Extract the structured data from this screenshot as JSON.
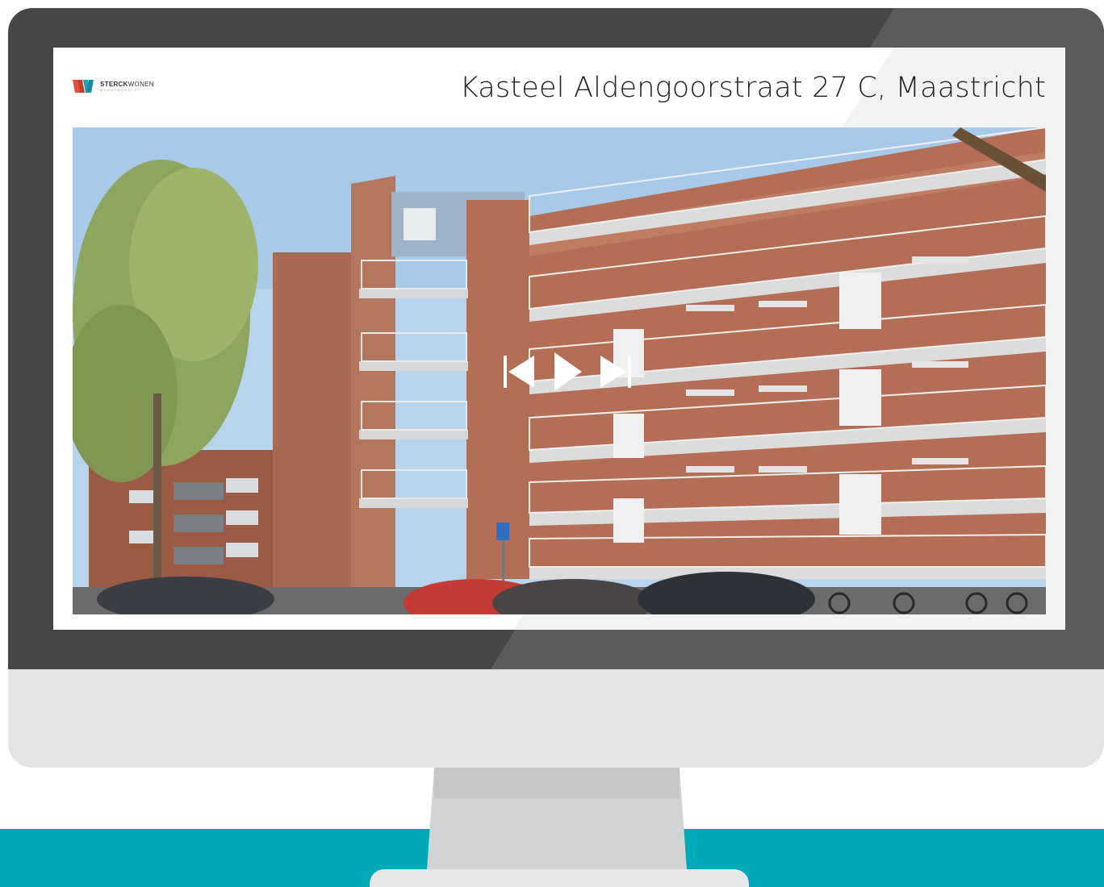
{
  "window": {
    "logo": {
      "name_bold": "STERCK",
      "name_light": "WONEN",
      "tagline": "MAKELAARDIJ"
    },
    "title": "Kasteel Aldengoorstraat 27 C, Maastricht"
  },
  "slideshow": {
    "controls": {
      "previous_icon": "skip-previous-icon",
      "play_icon": "play-icon",
      "next_icon": "skip-next-icon"
    }
  },
  "colors": {
    "bezel": "#464646",
    "chin": "#e3e4e6",
    "floor": "#00a9b8",
    "logo_accent_red": "#e0503a",
    "logo_accent_teal": "#1aa3b5"
  }
}
